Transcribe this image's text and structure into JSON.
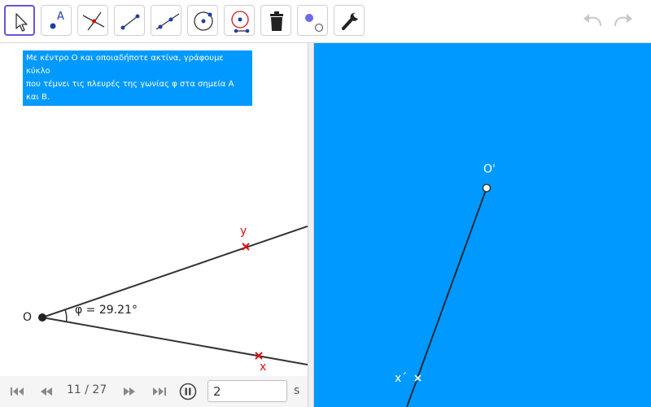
{
  "toolbar": {
    "tools": [
      {
        "name": "move"
      },
      {
        "name": "point",
        "label": "A"
      },
      {
        "name": "intersect"
      },
      {
        "name": "segment"
      },
      {
        "name": "ray"
      },
      {
        "name": "circle-center-point"
      },
      {
        "name": "compass"
      },
      {
        "name": "delete"
      },
      {
        "name": "show-hide-object"
      },
      {
        "name": "settings"
      }
    ]
  },
  "caption": {
    "line1": "Με κέντρο Ο και οποιαδήποτε ακτίνα, γράφουμε κύκλο",
    "line2": "που τέμνει τις πλευρές της γωνίας φ στα σημεία Α και Β."
  },
  "left_view": {
    "vertex_label": "O",
    "ray_top_label": "y",
    "ray_bottom_label": "x",
    "angle_label": "φ = 29.21°"
  },
  "right_view": {
    "vertex_label": "O'",
    "ray_point_label": "x´"
  },
  "playbar": {
    "page": "11 / 27",
    "speed_value": "2",
    "speed_unit": "s"
  },
  "colors": {
    "accent": "#6557d2",
    "caption_bg": "#0099ff",
    "right_bg": "#0099ff",
    "point_red": "#dd1111",
    "line": "#333333"
  }
}
